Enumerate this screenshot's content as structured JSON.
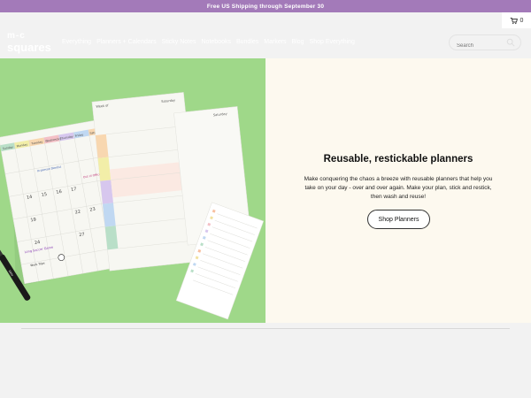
{
  "promo": {
    "text": "Free US Shipping through September 30"
  },
  "cart": {
    "count": "0",
    "icon": "shopping-cart-icon"
  },
  "logo": {
    "line1": "m-c",
    "line2": "squares"
  },
  "nav": {
    "items": [
      {
        "label": "Everything",
        "slug": "everything"
      },
      {
        "label": "Planners + Calendars",
        "slug": "planners-calendars"
      },
      {
        "label": "Sticky Notes",
        "slug": "sticky-notes"
      },
      {
        "label": "Notebooks",
        "slug": "notebooks"
      },
      {
        "label": "Bundles",
        "slug": "bundles"
      },
      {
        "label": "Markers",
        "slug": "markers"
      },
      {
        "label": "Blog",
        "slug": "blog"
      },
      {
        "label": "Shop Everything",
        "slug": "shop-everything"
      }
    ]
  },
  "search": {
    "placeholder": "Search",
    "icon": "search-icon"
  },
  "hero": {
    "title": "Reusable, restickable planners",
    "text": "Make conquering the chaos a breeze with reusable planners that help you take on your day - over and over again. Make your plan, stick and restick, then wash and reuse!",
    "button": "Shop Planners",
    "background": "#9fd889"
  },
  "illustration": {
    "weekdays": [
      "Sunday",
      "Monday",
      "Tuesday",
      "Wednesday",
      "Thursday",
      "Friday",
      "Saturday"
    ],
    "week_of": "Week of",
    "notes": [
      "14",
      "15",
      "16",
      "17",
      "19",
      "22",
      "23",
      "24",
      "27",
      "In-person Dentist",
      "Out of Office",
      "Long Soccer Game",
      "Work Trips",
      "Ditto"
    ]
  },
  "colors": {
    "promo": "#a37ab9",
    "accent_green": "#9fd889",
    "cream": "#fdf9ef"
  }
}
